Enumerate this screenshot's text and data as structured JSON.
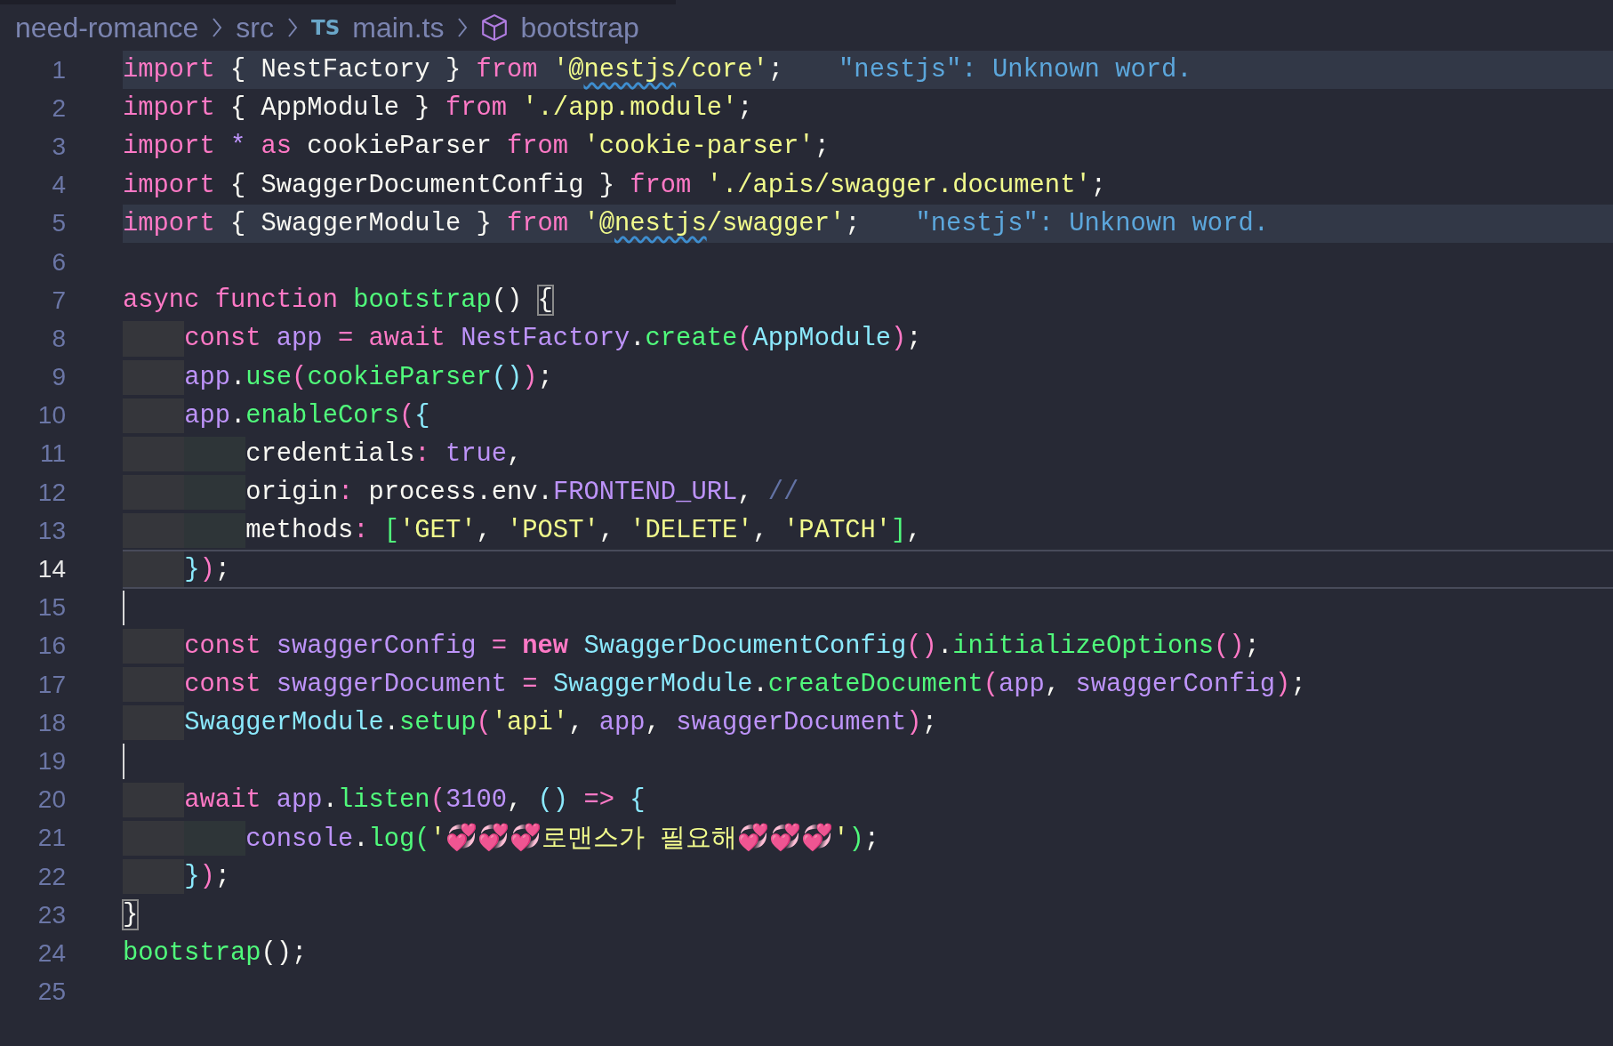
{
  "breadcrumb": [
    {
      "kind": "folder",
      "label": "need-romance"
    },
    {
      "kind": "folder",
      "label": "src"
    },
    {
      "kind": "file",
      "badge": "TS",
      "label": "main.ts"
    },
    {
      "kind": "symbol",
      "label": "bootstrap"
    }
  ],
  "lines": [
    {
      "number": "1",
      "highlighted": true,
      "current": false,
      "hint": "\"nestjs\": Unknown word.",
      "tokens": [
        {
          "kind": "kw",
          "text": "import"
        },
        {
          "kind": "plain",
          "text": " { NestFactory } "
        },
        {
          "kind": "kw",
          "text": "from "
        },
        {
          "kind": "str",
          "text": "'@"
        },
        {
          "kind": "flag",
          "text": "nestjs"
        },
        {
          "kind": "str",
          "text": "/core'"
        },
        {
          "kind": "plain",
          "text": ";"
        }
      ]
    },
    {
      "number": "2",
      "highlighted": false,
      "current": false,
      "tokens": [
        {
          "kind": "kw",
          "text": "import"
        },
        {
          "kind": "plain",
          "text": " { AppModule } "
        },
        {
          "kind": "kw",
          "text": "from "
        },
        {
          "kind": "str",
          "text": "'./app.module'"
        },
        {
          "kind": "plain",
          "text": ";"
        }
      ]
    },
    {
      "number": "3",
      "highlighted": false,
      "current": false,
      "tokens": [
        {
          "kind": "kw",
          "text": "import "
        },
        {
          "kind": "var",
          "text": "* "
        },
        {
          "kind": "kw",
          "text": "as"
        },
        {
          "kind": "plain",
          "text": " cookieParser "
        },
        {
          "kind": "kw",
          "text": "from "
        },
        {
          "kind": "str",
          "text": "'cookie-parser'"
        },
        {
          "kind": "plain",
          "text": ";"
        }
      ]
    },
    {
      "number": "4",
      "highlighted": false,
      "current": false,
      "tokens": [
        {
          "kind": "kw",
          "text": "import"
        },
        {
          "kind": "plain",
          "text": " { SwaggerDocumentConfig } "
        },
        {
          "kind": "kw",
          "text": "from "
        },
        {
          "kind": "str",
          "text": "'./apis/swagger.document'"
        },
        {
          "kind": "plain",
          "text": ";"
        }
      ]
    },
    {
      "number": "5",
      "highlighted": true,
      "current": false,
      "hint": "\"nestjs\": Unknown word.",
      "tokens": [
        {
          "kind": "kw",
          "text": "import"
        },
        {
          "kind": "plain",
          "text": " { SwaggerModule } "
        },
        {
          "kind": "kw",
          "text": "from "
        },
        {
          "kind": "str",
          "text": "'@"
        },
        {
          "kind": "flag",
          "text": "nestjs"
        },
        {
          "kind": "str",
          "text": "/swagger'"
        },
        {
          "kind": "plain",
          "text": ";"
        }
      ]
    },
    {
      "number": "6",
      "highlighted": false,
      "current": false
    },
    {
      "number": "7",
      "highlighted": false,
      "current": false,
      "tokens": [
        {
          "kind": "kw",
          "text": "async function "
        },
        {
          "kind": "fn",
          "text": "bootstrap"
        },
        {
          "kind": "plain",
          "text": "() "
        },
        {
          "kind": "match",
          "text": "{"
        }
      ]
    },
    {
      "number": "8",
      "highlighted": false,
      "current": false,
      "tokens": [
        {
          "kind": "kw",
          "text": "    const "
        },
        {
          "kind": "var",
          "text": "app "
        },
        {
          "kind": "kw",
          "text": "= await "
        },
        {
          "kind": "var",
          "text": "NestFactory"
        },
        {
          "kind": "plain",
          "text": "."
        },
        {
          "kind": "fn",
          "text": "create"
        },
        {
          "kind": "p1",
          "text": "("
        },
        {
          "kind": "cls",
          "text": "AppModule"
        },
        {
          "kind": "p1",
          "text": ")"
        },
        {
          "kind": "plain",
          "text": ";"
        }
      ]
    },
    {
      "number": "9",
      "highlighted": false,
      "current": false,
      "tokens": [
        {
          "kind": "var",
          "text": "    app"
        },
        {
          "kind": "plain",
          "text": "."
        },
        {
          "kind": "fn",
          "text": "use"
        },
        {
          "kind": "p1",
          "text": "("
        },
        {
          "kind": "fn",
          "text": "cookieParser"
        },
        {
          "kind": "p2",
          "text": "()"
        },
        {
          "kind": "p1",
          "text": ")"
        },
        {
          "kind": "plain",
          "text": ";"
        }
      ]
    },
    {
      "number": "10",
      "highlighted": false,
      "current": false,
      "tokens": [
        {
          "kind": "var",
          "text": "    app"
        },
        {
          "kind": "plain",
          "text": "."
        },
        {
          "kind": "fn",
          "text": "enableCors"
        },
        {
          "kind": "p1",
          "text": "("
        },
        {
          "kind": "p2",
          "text": "{"
        }
      ]
    },
    {
      "number": "11",
      "highlighted": false,
      "current": false,
      "tokens": [
        {
          "kind": "plain",
          "text": "        credentials"
        },
        {
          "kind": "kw",
          "text": ": "
        },
        {
          "kind": "var",
          "text": "true"
        },
        {
          "kind": "plain",
          "text": ","
        }
      ]
    },
    {
      "number": "12",
      "highlighted": false,
      "current": false,
      "tokens": [
        {
          "kind": "plain",
          "text": "        origin"
        },
        {
          "kind": "kw",
          "text": ":"
        },
        {
          "kind": "plain",
          "text": " process.env."
        },
        {
          "kind": "var",
          "text": "FRONTEND_URL"
        },
        {
          "kind": "plain",
          "text": ", "
        },
        {
          "kind": "comment",
          "text": "//"
        }
      ]
    },
    {
      "number": "13",
      "highlighted": false,
      "current": false,
      "tokens": [
        {
          "kind": "plain",
          "text": "        methods"
        },
        {
          "kind": "kw",
          "text": ": "
        },
        {
          "kind": "p3",
          "text": "["
        },
        {
          "kind": "str",
          "text": "'GET'"
        },
        {
          "kind": "plain",
          "text": ", "
        },
        {
          "kind": "str",
          "text": "'POST'"
        },
        {
          "kind": "plain",
          "text": ", "
        },
        {
          "kind": "str",
          "text": "'DELETE'"
        },
        {
          "kind": "plain",
          "text": ", "
        },
        {
          "kind": "str",
          "text": "'PATCH'"
        },
        {
          "kind": "p3",
          "text": "]"
        },
        {
          "kind": "plain",
          "text": ","
        }
      ]
    },
    {
      "number": "14",
      "highlighted": false,
      "current": true,
      "tokens": [
        {
          "kind": "p2",
          "text": "    }"
        },
        {
          "kind": "p1",
          "text": ")"
        },
        {
          "kind": "plain",
          "text": ";"
        }
      ]
    },
    {
      "number": "15",
      "highlighted": false,
      "current": false
    },
    {
      "number": "16",
      "highlighted": false,
      "current": false,
      "tokens": [
        {
          "kind": "kw",
          "text": "    const "
        },
        {
          "kind": "var",
          "text": "swaggerConfig "
        },
        {
          "kind": "kw",
          "text": "= "
        },
        {
          "kind": "kwb",
          "text": "new "
        },
        {
          "kind": "cls",
          "text": "SwaggerDocumentConfig"
        },
        {
          "kind": "p1",
          "text": "()"
        },
        {
          "kind": "plain",
          "text": "."
        },
        {
          "kind": "fn",
          "text": "initializeOptions"
        },
        {
          "kind": "p1",
          "text": "()"
        },
        {
          "kind": "plain",
          "text": ";"
        }
      ]
    },
    {
      "number": "17",
      "highlighted": false,
      "current": false,
      "tokens": [
        {
          "kind": "kw",
          "text": "    const "
        },
        {
          "kind": "var",
          "text": "swaggerDocument "
        },
        {
          "kind": "kw",
          "text": "= "
        },
        {
          "kind": "cls",
          "text": "SwaggerModule"
        },
        {
          "kind": "plain",
          "text": "."
        },
        {
          "kind": "fn",
          "text": "createDocument"
        },
        {
          "kind": "p1",
          "text": "("
        },
        {
          "kind": "var",
          "text": "app"
        },
        {
          "kind": "plain",
          "text": ", "
        },
        {
          "kind": "var",
          "text": "swaggerConfig"
        },
        {
          "kind": "p1",
          "text": ")"
        },
        {
          "kind": "plain",
          "text": ";"
        }
      ]
    },
    {
      "number": "18",
      "highlighted": false,
      "current": false,
      "tokens": [
        {
          "kind": "cls",
          "text": "    SwaggerModule"
        },
        {
          "kind": "plain",
          "text": "."
        },
        {
          "kind": "fn",
          "text": "setup"
        },
        {
          "kind": "p1",
          "text": "("
        },
        {
          "kind": "str",
          "text": "'api'"
        },
        {
          "kind": "plain",
          "text": ", "
        },
        {
          "kind": "var",
          "text": "app"
        },
        {
          "kind": "plain",
          "text": ", "
        },
        {
          "kind": "var",
          "text": "swaggerDocument"
        },
        {
          "kind": "p1",
          "text": ")"
        },
        {
          "kind": "plain",
          "text": ";"
        }
      ]
    },
    {
      "number": "19",
      "highlighted": false,
      "current": false
    },
    {
      "number": "20",
      "highlighted": false,
      "current": false,
      "tokens": [
        {
          "kind": "kw",
          "text": "    await "
        },
        {
          "kind": "var",
          "text": "app"
        },
        {
          "kind": "plain",
          "text": "."
        },
        {
          "kind": "fn",
          "text": "listen"
        },
        {
          "kind": "p1",
          "text": "("
        },
        {
          "kind": "var",
          "text": "3100"
        },
        {
          "kind": "plain",
          "text": ", "
        },
        {
          "kind": "p2",
          "text": "() "
        },
        {
          "kind": "kw",
          "text": "=> "
        },
        {
          "kind": "p2",
          "text": "{"
        }
      ]
    },
    {
      "number": "21",
      "highlighted": false,
      "current": false,
      "tokens": [
        {
          "kind": "var",
          "text": "        console"
        },
        {
          "kind": "plain",
          "text": "."
        },
        {
          "kind": "fn",
          "text": "log"
        },
        {
          "kind": "p3",
          "text": "("
        },
        {
          "kind": "str",
          "text": "'💞💞💞로맨스가 필요해💞💞💞'"
        },
        {
          "kind": "p3",
          "text": ")"
        },
        {
          "kind": "plain",
          "text": ";"
        }
      ]
    },
    {
      "number": "22",
      "highlighted": false,
      "current": false,
      "tokens": [
        {
          "kind": "p2",
          "text": "    }"
        },
        {
          "kind": "p1",
          "text": ")"
        },
        {
          "kind": "plain",
          "text": ";"
        }
      ]
    },
    {
      "number": "23",
      "highlighted": false,
      "current": false,
      "tokens": [
        {
          "kind": "match",
          "text": "}"
        }
      ]
    },
    {
      "number": "24",
      "highlighted": false,
      "current": false,
      "tokens": [
        {
          "kind": "fn",
          "text": "bootstrap"
        },
        {
          "kind": "plain",
          "text": "();"
        }
      ]
    },
    {
      "number": "25",
      "highlighted": false,
      "current": false
    }
  ]
}
